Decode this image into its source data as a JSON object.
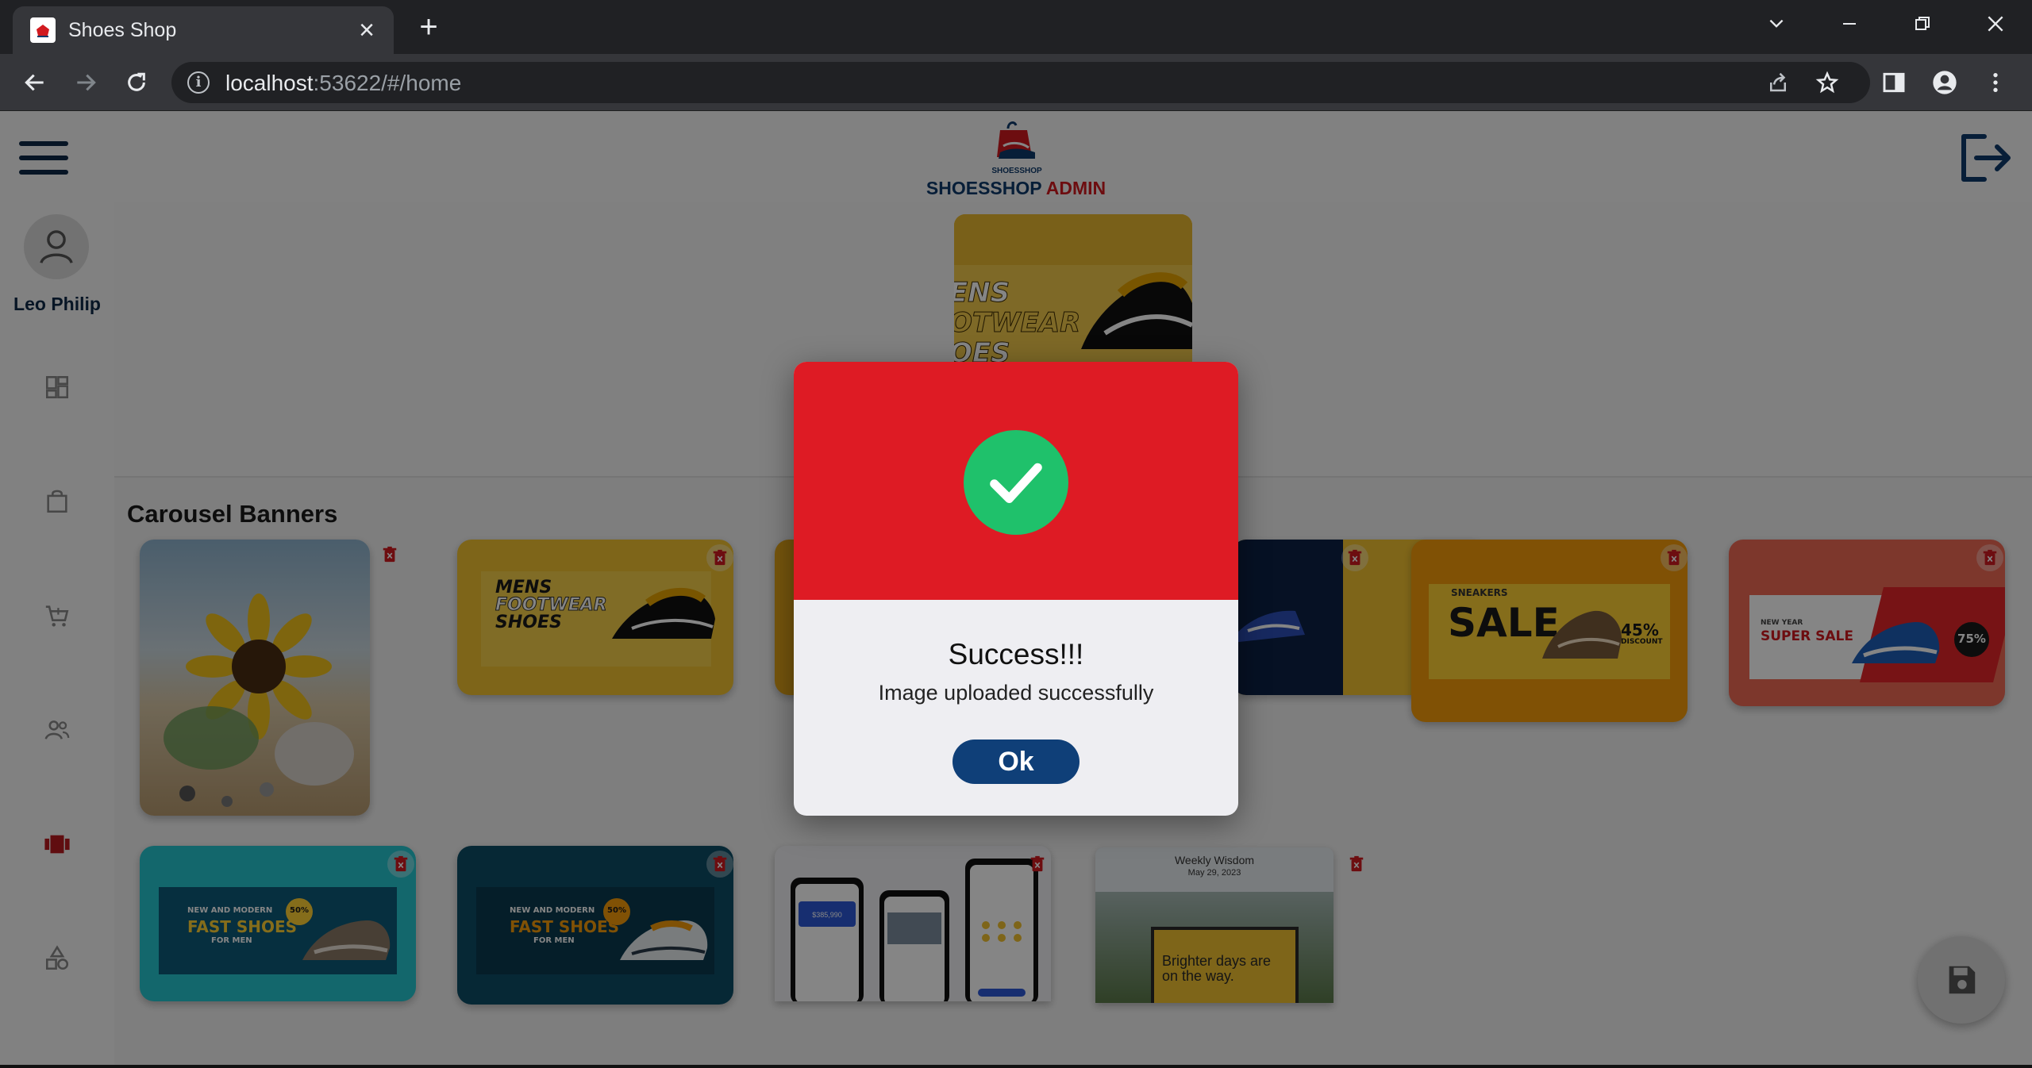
{
  "browser": {
    "tab_title": "Shoes Shop",
    "tab_close": "×",
    "new_tab": "+",
    "url_host": "localhost",
    "url_rest": ":53622/#/home"
  },
  "header": {
    "brand_part1": "SHOESSHOP",
    "brand_part2": " ADMIN",
    "logo_caption": "SHOESSHOP"
  },
  "sidebar": {
    "user_name": "Leo Philip",
    "items": [
      {
        "icon": "dashboard-icon"
      },
      {
        "icon": "shopping-bag-icon"
      },
      {
        "icon": "cart-icon"
      },
      {
        "icon": "users-icon"
      },
      {
        "icon": "carousel-icon",
        "active": true
      },
      {
        "icon": "categories-icon"
      }
    ]
  },
  "main": {
    "section_title": "Carousel Banners",
    "preview_banner": {
      "line1": "ENS",
      "line2": "OTWEAR",
      "line3": "OES"
    },
    "banners": [
      {
        "name": "sunflower-beach",
        "text": ""
      },
      {
        "name": "mens-footwear",
        "line1": "MENS",
        "line2": "FOOTWEAR",
        "line3": "SHOES"
      },
      {
        "name": "yellow-partial",
        "text": ""
      },
      {
        "name": "nike-yellow",
        "text": ""
      },
      {
        "name": "sneakers-sale",
        "small": "SNEAKERS",
        "big": "SALE",
        "badge": "45%",
        "badge_sub": "DISCOUNT"
      },
      {
        "name": "new-year-super-sale",
        "small": "NEW YEAR",
        "big": "SUPER SALE",
        "badge": "75%"
      },
      {
        "name": "fast-shoes-teal",
        "small": "NEW AND MODERN",
        "big": "FAST SHOES",
        "sub": "FOR MEN",
        "badge": "50%"
      },
      {
        "name": "fast-shoes-dark",
        "small": "NEW AND MODERN",
        "big": "FAST SHOES",
        "sub": "FOR MEN",
        "badge": "50%"
      },
      {
        "name": "phone-mockups",
        "price": "$385,990"
      },
      {
        "name": "weekly-wisdom",
        "title": "Weekly Wisdom",
        "date": "May 29, 2023",
        "quote": "Brighter days are on the way."
      }
    ]
  },
  "dialog": {
    "title": "Success!!!",
    "message": "Image uploaded successfully",
    "ok_label": "Ok"
  },
  "colors": {
    "brand_navy": "#0e3a6b",
    "brand_red": "#d11a1f",
    "dialog_red": "#de1b24",
    "success_green": "#1fc16b",
    "ok_button": "#0f3f78"
  }
}
